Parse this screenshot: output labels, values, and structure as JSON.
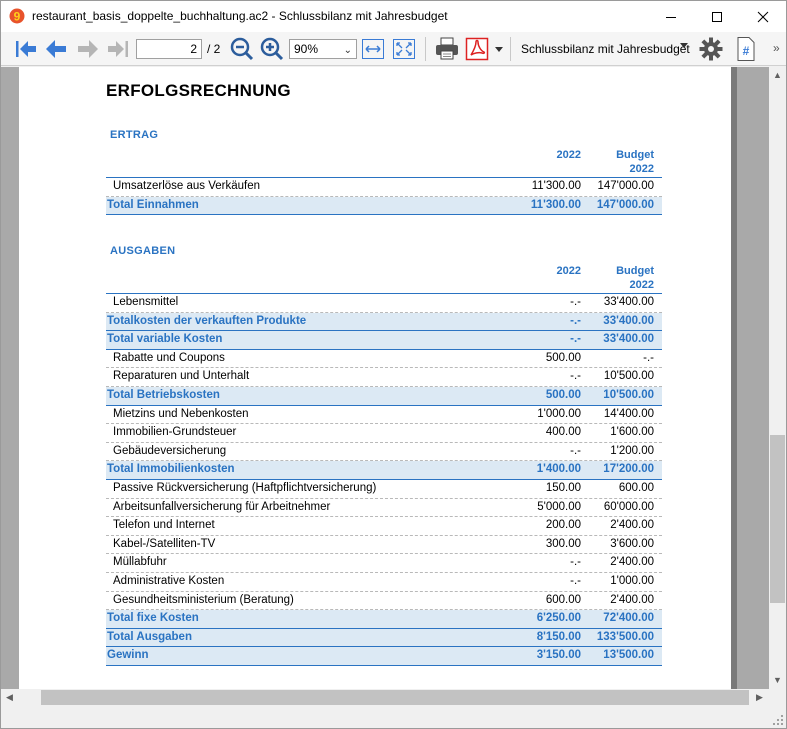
{
  "window": {
    "title": "restaurant_basis_doppelte_buchhaltung.ac2 - Schlussbilanz mit Jahresbudget"
  },
  "toolbar": {
    "page_current": "2",
    "page_total": "/ 2",
    "zoom": "90%",
    "report_name": "Schlussbilanz mit Jahresbudget",
    "overflow": "»"
  },
  "colors": {
    "accent": "#2a73c2",
    "total_row_bg": "#dce9f4"
  },
  "report": {
    "title": "ERFOLGSRECHNUNG",
    "ertrag": {
      "label": "ERTRAG",
      "col1": "2022",
      "col2_line1": "Budget",
      "col2_line2": "2022",
      "rows": [
        {
          "label": "Umsatzerlöse aus Verkäufen",
          "v1": "11'300.00",
          "v2": "147'000.00",
          "total": false
        },
        {
          "label": "Total Einnahmen",
          "v1": "11'300.00",
          "v2": "147'000.00",
          "total": true
        }
      ]
    },
    "ausgaben": {
      "label": "AUSGABEN",
      "col1": "2022",
      "col2_line1": "Budget",
      "col2_line2": "2022",
      "rows": [
        {
          "label": "Lebensmittel",
          "v1": "-.-",
          "v2": "33'400.00",
          "total": false
        },
        {
          "label": "Totalkosten der verkauften Produkte",
          "v1": "-.-",
          "v2": "33'400.00",
          "total": true
        },
        {
          "label": "Total variable Kosten",
          "v1": "-.-",
          "v2": "33'400.00",
          "total": true
        },
        {
          "label": "Rabatte und Coupons",
          "v1": "500.00",
          "v2": "-.-",
          "total": false
        },
        {
          "label": "Reparaturen und Unterhalt",
          "v1": "-.-",
          "v2": "10'500.00",
          "total": false
        },
        {
          "label": "Total Betriebskosten",
          "v1": "500.00",
          "v2": "10'500.00",
          "total": true
        },
        {
          "label": "Mietzins und Nebenkosten",
          "v1": "1'000.00",
          "v2": "14'400.00",
          "total": false
        },
        {
          "label": "Immobilien-Grundsteuer",
          "v1": "400.00",
          "v2": "1'600.00",
          "total": false
        },
        {
          "label": "Gebäudeversicherung",
          "v1": "-.-",
          "v2": "1'200.00",
          "total": false
        },
        {
          "label": "Total Immobilienkosten",
          "v1": "1'400.00",
          "v2": "17'200.00",
          "total": true
        },
        {
          "label": "Passive Rückversicherung (Haftpflichtversicherung)",
          "v1": "150.00",
          "v2": "600.00",
          "total": false
        },
        {
          "label": "Arbeitsunfallversicherung für Arbeitnehmer",
          "v1": "5'000.00",
          "v2": "60'000.00",
          "total": false
        },
        {
          "label": "Telefon und Internet",
          "v1": "200.00",
          "v2": "2'400.00",
          "total": false
        },
        {
          "label": "Kabel-/Satelliten-TV",
          "v1": "300.00",
          "v2": "3'600.00",
          "total": false
        },
        {
          "label": "Müllabfuhr",
          "v1": "-.-",
          "v2": "2'400.00",
          "total": false
        },
        {
          "label": "Administrative Kosten",
          "v1": "-.-",
          "v2": "1'000.00",
          "total": false
        },
        {
          "label": "Gesundheitsministerium (Beratung)",
          "v1": "600.00",
          "v2": "2'400.00",
          "total": false
        },
        {
          "label": "Total fixe Kosten",
          "v1": "6'250.00",
          "v2": "72'400.00",
          "total": true
        },
        {
          "label": "Total Ausgaben",
          "v1": "8'150.00",
          "v2": "133'500.00",
          "total": true
        },
        {
          "label": "Gewinn",
          "v1": "3'150.00",
          "v2": "13'500.00",
          "total": true
        }
      ]
    }
  }
}
